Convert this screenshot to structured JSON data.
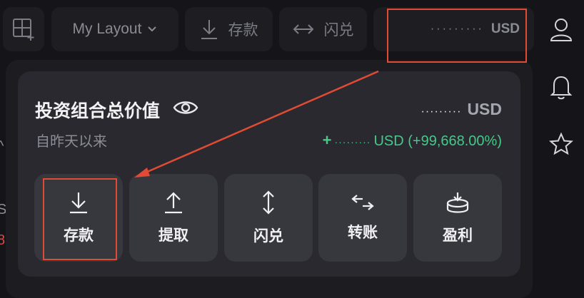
{
  "toolbar": {
    "layout_label": "My Layout",
    "deposit_label": "存款",
    "flash_label": "闪兑",
    "balance_mask": "·········",
    "balance_currency": "USD"
  },
  "side_rail": {
    "icons": [
      "user-icon",
      "bell-icon",
      "star-icon"
    ]
  },
  "left_fragments": [
    "^",
    "S",
    "8"
  ],
  "portfolio": {
    "title": "投资组合总价值",
    "subtitle": "自昨天以来",
    "total_mask": "·········",
    "total_currency": "USD",
    "change_plus": "+",
    "change_mask": "·········",
    "change_text": "USD (+99,668.00%)"
  },
  "actions": [
    {
      "label": "存款",
      "icon": "download-icon"
    },
    {
      "label": "提取",
      "icon": "upload-icon"
    },
    {
      "label": "闪兑",
      "icon": "swap-vertical-icon"
    },
    {
      "label": "转账",
      "icon": "transfer-icon"
    },
    {
      "label": "盈利",
      "icon": "earn-icon"
    }
  ],
  "colors": {
    "background": "#151519",
    "panel": "#1c1c21",
    "card": "#29292f",
    "button": "#37373e",
    "positive": "#45c98a",
    "annotation": "#e04b35"
  }
}
